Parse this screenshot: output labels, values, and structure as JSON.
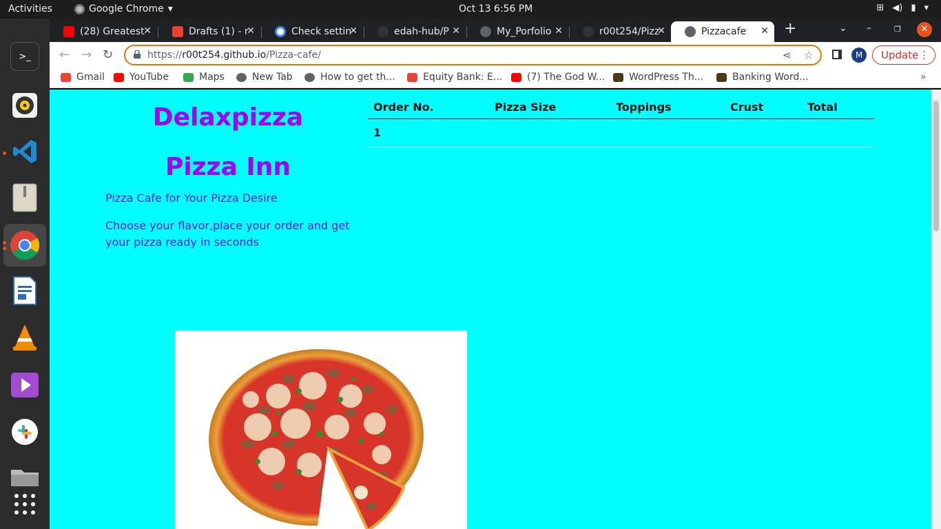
{
  "system": {
    "activities": "Activities",
    "app_name": "Google Chrome",
    "clock": "Oct 13  6:56 PM"
  },
  "browser": {
    "tabs": [
      {
        "label": "(28) Greatest",
        "icon": "youtube-icon",
        "color": "#ff0000"
      },
      {
        "label": "Drafts (1) - r",
        "icon": "gmail-icon",
        "color": "#ea4335"
      },
      {
        "label": "Check settin",
        "icon": "google-icon",
        "color": "#4285f4"
      },
      {
        "label": "edah-hub/P",
        "icon": "github-icon",
        "color": "#333333"
      },
      {
        "label": "My_Porfolio",
        "icon": "globe-icon",
        "color": "#5f6368"
      },
      {
        "label": "r00t254/Pizz",
        "icon": "github-icon",
        "color": "#333333"
      },
      {
        "label": "Pizzacafe",
        "icon": "globe-icon",
        "color": "#5f6368"
      }
    ],
    "active_tab_index": 6,
    "url_prefix": "https://",
    "url_host": "r00t254.github.io",
    "url_path": "/Pizza-cafe/",
    "update_label": "Update",
    "avatar_letter": "M",
    "bookmarks": [
      {
        "label": "Gmail",
        "icon": "gmail-icon",
        "color": "#ea4335"
      },
      {
        "label": "YouTube",
        "icon": "youtube-icon",
        "color": "#ff0000"
      },
      {
        "label": "Maps",
        "icon": "maps-icon",
        "color": "#34a853"
      },
      {
        "label": "New Tab",
        "icon": "globe-icon",
        "color": "#5f6368"
      },
      {
        "label": "How to get th...",
        "icon": "globe-icon",
        "color": "#5f6368"
      },
      {
        "label": "Equity Bank: E...",
        "icon": "gmail-icon",
        "color": "#ea4335"
      },
      {
        "label": "(7) The God W...",
        "icon": "youtube-icon",
        "color": "#ff0000"
      },
      {
        "label": "WordPress Th...",
        "icon": "wordpress-icon",
        "color": "#4a3a1a"
      },
      {
        "label": "Banking Word...",
        "icon": "wordpress-icon",
        "color": "#4a3a1a"
      }
    ]
  },
  "page": {
    "title": "Delaxpizza",
    "subtitle": "Pizza Inn",
    "tagline": "Pizza Cafe for Your Pizza Desire",
    "description": "Choose your flavor,place your order and get your pizza ready in seconds",
    "bg_color": "#00ffff",
    "accent": "#a600f0",
    "table": {
      "headers": [
        "Order No.",
        "Pizza Size",
        "Toppings",
        "Crust",
        "Total"
      ],
      "rows": [
        [
          "1",
          "",
          "",
          "",
          ""
        ]
      ]
    }
  }
}
